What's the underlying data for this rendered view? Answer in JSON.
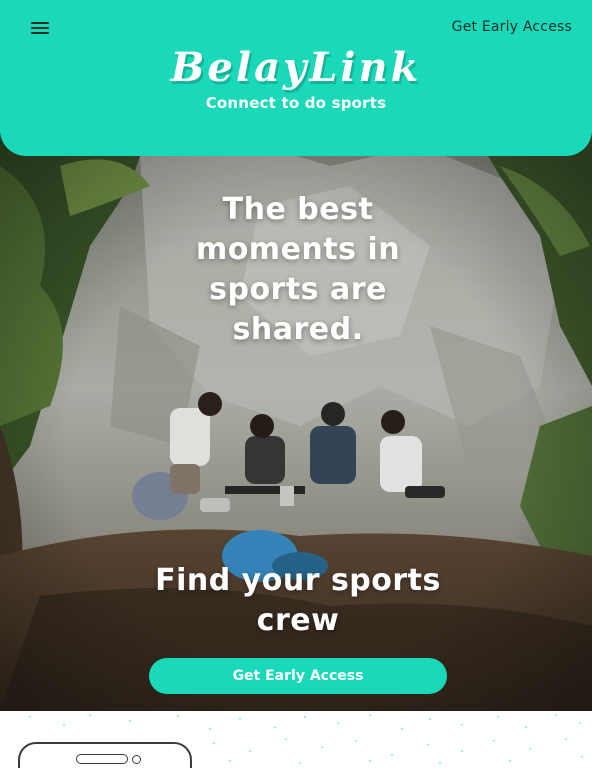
{
  "header": {
    "menu_icon": "hamburger-menu-icon",
    "cta_label": "Get Early Access",
    "logo_text": "BelayLink",
    "tagline": "Connect to do sports",
    "background_color": "#1ad9b9"
  },
  "hero": {
    "headline": "The best moments in sports are shared.",
    "subheadline": "Find your sports crew",
    "button_label": "Get Early Access",
    "image_description_icon": "photo-climbers-camping"
  },
  "below_fold": {
    "illustration_icon": "phone-sketch-icon"
  },
  "colors": {
    "accent": "#1ad9b9",
    "text_light": "#ffffff",
    "text_dark": "#0f2f2a"
  }
}
